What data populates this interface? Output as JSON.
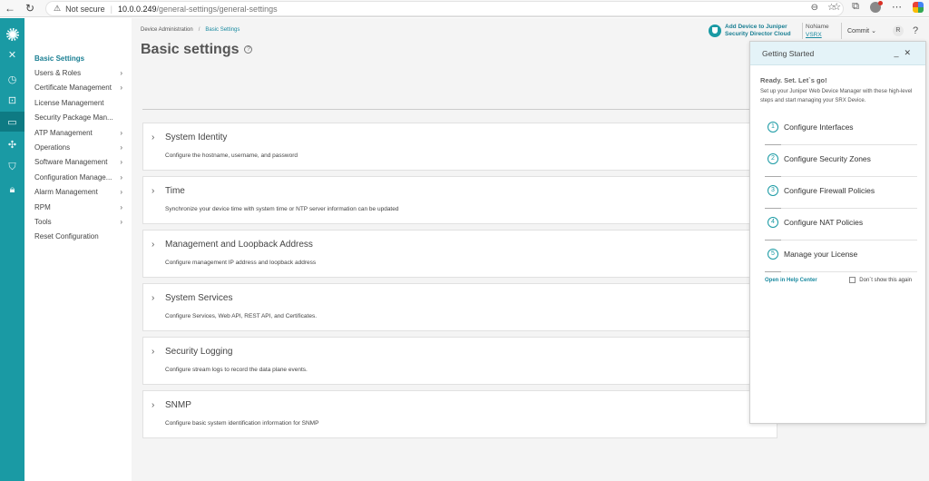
{
  "browser": {
    "security_label": "Not secure",
    "url_host": "10.0.0.249",
    "url_path": "/general-settings/general-settings"
  },
  "header": {
    "breadcrumb_parent": "Device Administration",
    "breadcrumb_current": "Basic Settings",
    "page_title": "Basic settings",
    "sd_line1": "Add Device to Juniper",
    "sd_line2": "Security Director Cloud",
    "device_name": "NoName",
    "device_model": "VSRX",
    "commit_label": "Commit",
    "avatar_initial": "R",
    "help_label": "?"
  },
  "nav": {
    "items": [
      {
        "label": "Basic Settings",
        "chevron": ""
      },
      {
        "label": "Users & Roles",
        "chevron": "›"
      },
      {
        "label": "Certificate Management",
        "chevron": "›"
      },
      {
        "label": "License Management",
        "chevron": ""
      },
      {
        "label": "Security Package Man...",
        "chevron": ""
      },
      {
        "label": "ATP Management",
        "chevron": "›"
      },
      {
        "label": "Operations",
        "chevron": "›"
      },
      {
        "label": "Software Management",
        "chevron": "›"
      },
      {
        "label": "Configuration Manage...",
        "chevron": "›"
      },
      {
        "label": "Alarm Management",
        "chevron": "›"
      },
      {
        "label": "RPM",
        "chevron": "›"
      },
      {
        "label": "Tools",
        "chevron": "›"
      },
      {
        "label": "Reset Configuration",
        "chevron": ""
      }
    ]
  },
  "rail": {
    "icons": [
      "juniper-logo-icon",
      "close-icon",
      "dashboard-icon",
      "monitor-icon",
      "device-icon",
      "network-icon",
      "shield-icon",
      "lock-icon"
    ]
  },
  "cards": [
    {
      "title": "System Identity",
      "desc": "Configure the hostname, username, and password"
    },
    {
      "title": "Time",
      "desc": "Synchronize your device time with system time or NTP server information can be updated"
    },
    {
      "title": "Management and Loopback Address",
      "desc": "Configure management IP address and loopback address"
    },
    {
      "title": "System Services",
      "desc": "Configure Services, Web API, REST API, and Certificates."
    },
    {
      "title": "Security Logging",
      "desc": "Configure stream logs to record the data plane events."
    },
    {
      "title": "SNMP",
      "desc": "Configure basic system identification information for SNMP"
    }
  ],
  "getting_started": {
    "title": "Getting Started",
    "ready": "Ready. Set. Let`s go!",
    "intro": "Set up your Juniper Web Device Manager with these high-level steps and start managing your SRX Device.",
    "steps": [
      {
        "num": "1",
        "label": "Configure Interfaces"
      },
      {
        "num": "2",
        "label": "Configure Security Zones"
      },
      {
        "num": "3",
        "label": "Configure Firewall Policies"
      },
      {
        "num": "4",
        "label": "Configure NAT Policies"
      },
      {
        "num": "5",
        "label": "Manage your License"
      }
    ],
    "help_link": "Open in Help Center",
    "dont_show": "Don`t show this again"
  },
  "colors": {
    "accent": "#1a9aa4",
    "accent_dark": "#0e7a83",
    "link": "#1a8aa0"
  }
}
